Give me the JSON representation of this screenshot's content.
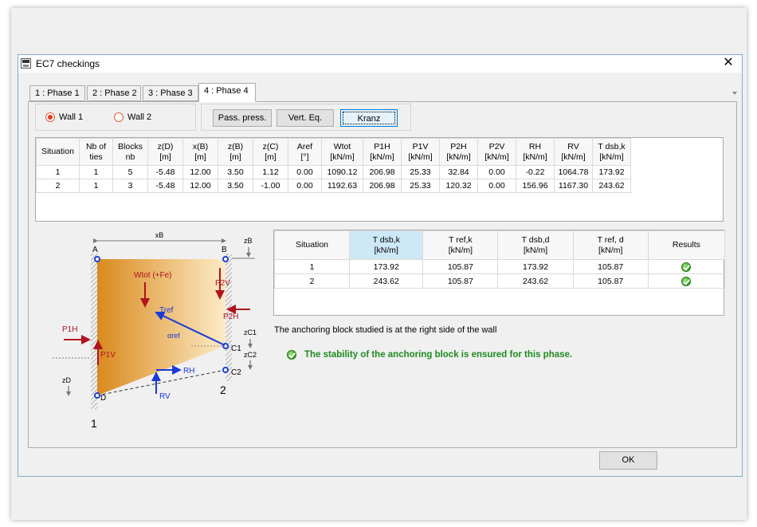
{
  "window": {
    "title": "EC7 checkings",
    "close_glyph": "✕"
  },
  "tabs": [
    {
      "label": "1 : Phase 1",
      "active": false
    },
    {
      "label": "2 : Phase 2",
      "active": false
    },
    {
      "label": "3 : Phase 3",
      "active": false
    },
    {
      "label": "4 : Phase 4",
      "active": true
    }
  ],
  "walls": {
    "wall1": "Wall 1",
    "wall2": "Wall 2",
    "selected": "Wall 1"
  },
  "buttons": {
    "pass_press": "Pass. press.",
    "vert_eq": "Vert. Eq.",
    "kranz": "Kranz",
    "ok": "OK"
  },
  "main_table": {
    "headers": [
      [
        "Situation",
        ""
      ],
      [
        "Nb of",
        "ties"
      ],
      [
        "Blocks",
        "nb"
      ],
      [
        "z(D)",
        "[m]"
      ],
      [
        "x(B)",
        "[m]"
      ],
      [
        "z(B)",
        "[m]"
      ],
      [
        "z(C)",
        "[m]"
      ],
      [
        "Aref",
        "[°]"
      ],
      [
        "Wtot",
        "[kN/m]"
      ],
      [
        "P1H",
        "[kN/m]"
      ],
      [
        "P1V",
        "[kN/m]"
      ],
      [
        "P2H",
        "[kN/m]"
      ],
      [
        "P2V",
        "[kN/m]"
      ],
      [
        "RH",
        "[kN/m]"
      ],
      [
        "RV",
        "[kN/m]"
      ],
      [
        "T dsb,k",
        "[kN/m]"
      ]
    ],
    "rows": [
      [
        "1",
        "1",
        "5",
        "-5.48",
        "12.00",
        "3.50",
        "1.12",
        "0.00",
        "1090.12",
        "206.98",
        "25.33",
        "32.84",
        "0.00",
        "-0.22",
        "1064.78",
        "173.92"
      ],
      [
        "2",
        "1",
        "3",
        "-5.48",
        "12.00",
        "3.50",
        "-1.00",
        "0.00",
        "1192.63",
        "206.98",
        "25.33",
        "120.32",
        "0.00",
        "156.96",
        "1167.30",
        "243.62"
      ]
    ]
  },
  "results_table": {
    "headers": [
      [
        "Situation",
        ""
      ],
      [
        "T dsb,k",
        "[kN/m]"
      ],
      [
        "T ref,k",
        "[kN/m]"
      ],
      [
        "T dsb,d",
        "[kN/m]"
      ],
      [
        "T ref, d",
        "[kN/m]"
      ],
      [
        "Results",
        ""
      ]
    ],
    "rows": [
      [
        "1",
        "173.92",
        "105.87",
        "173.92",
        "105.87"
      ],
      [
        "2",
        "243.62",
        "105.87",
        "243.62",
        "105.87"
      ]
    ]
  },
  "messages": {
    "side": "The anchoring block studied is at the right side of the wall",
    "stability": "The stability of the anchoring block is ensured for this phase."
  },
  "diagram": {
    "label_xB": "xB",
    "label_zB": "zB",
    "label_A": "A",
    "label_B": "B",
    "label_Wtot": "Wtot (+Fe)",
    "label_P2V": "P2V",
    "label_P2H": "P2H",
    "label_Tref": "Tref",
    "label_alpha": "αref",
    "label_P1H": "P1H",
    "label_P1V": "P1V",
    "label_C1": "C1",
    "label_C2": "C2",
    "label_zC1": "zC1",
    "label_zC2": "zC2",
    "label_zD": "zD",
    "label_RH": "RH",
    "label_RV": "RV",
    "label_D": "D",
    "label_1": "1",
    "label_2": "2",
    "colors": {
      "block_dark": "#d98a1e",
      "block_light": "#fdebc6",
      "force_red": "#b0131e",
      "force_blue": "#1a39d6",
      "node": "#1f3fd0"
    }
  },
  "colors": {
    "accent": "#0078d7",
    "success": "#1f8a1f",
    "radio": "#e23a1e"
  }
}
